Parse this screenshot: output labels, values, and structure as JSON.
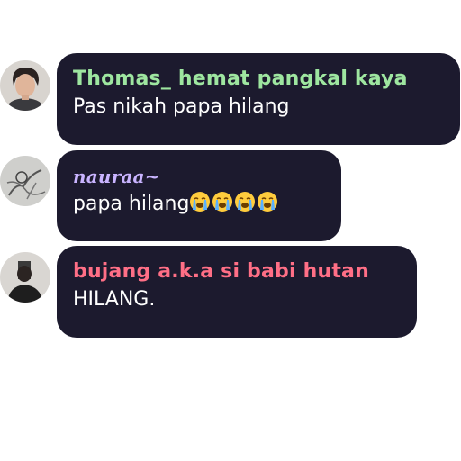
{
  "messages": [
    {
      "username": "Thomas_ hemat pangkal kaya",
      "username_color": "#9ee6a0",
      "text": "Pas nikah papa hilang",
      "avatar": "man-portrait-avatar"
    },
    {
      "username": "nauraa~",
      "username_color": "#c9b4ff",
      "text": "papa hilang",
      "emoji": [
        "loudly-crying-face-icon",
        "loudly-crying-face-icon",
        "loudly-crying-face-icon",
        "loudly-crying-face-icon"
      ],
      "avatar": "sketch-portrait-avatar"
    },
    {
      "username": "bujang a.k.a si babi hutan",
      "username_color": "#ff6f86",
      "text": "HILANG.",
      "avatar": "dark-figure-avatar"
    }
  ],
  "colors": {
    "bubble_bg": "#1c1a2e",
    "text": "#ffffff",
    "page_bg": "#ffffff"
  }
}
